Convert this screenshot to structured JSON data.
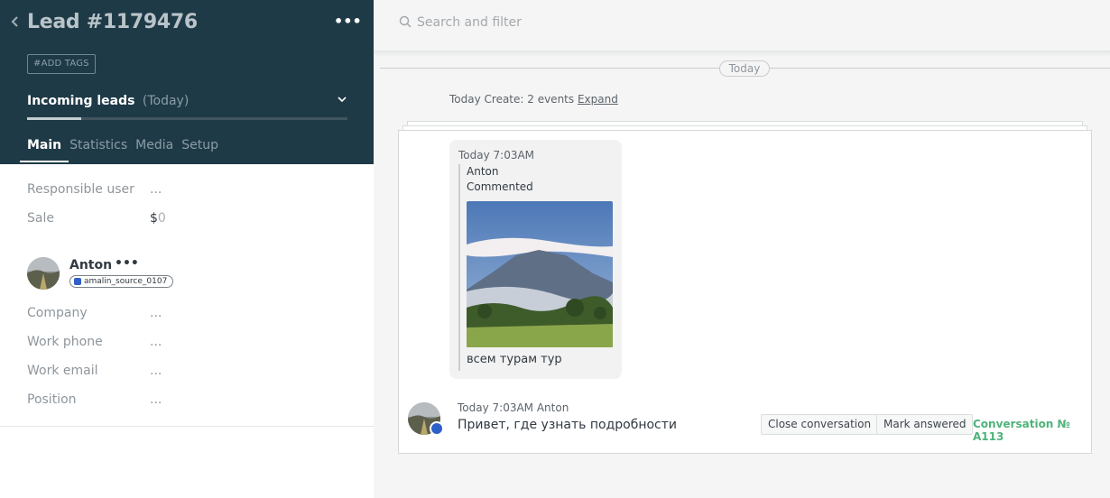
{
  "lead": {
    "back_icon": "chevron-left-icon",
    "title": "Lead #1179476",
    "more_label": "•••",
    "add_tags_label": "#ADD TAGS",
    "pipeline_name": "Incoming leads",
    "pipeline_when": "(Today)",
    "pipeline_progress": 0.17,
    "tabs": [
      "Main",
      "Statistics",
      "Media",
      "Setup"
    ],
    "active_tab": "Main"
  },
  "fields": {
    "responsible_label": "Responsible user",
    "responsible_value": "...",
    "sale_label": "Sale",
    "sale_currency": "$",
    "sale_amount": "0"
  },
  "contact": {
    "name": "Anton",
    "more_label": "•••",
    "source_tag": "amalin_source_0107",
    "company_label": "Company",
    "company_value": "...",
    "work_phone_label": "Work phone",
    "work_phone_value": "...",
    "work_email_label": "Work email",
    "work_email_value": "...",
    "position_label": "Position",
    "position_value": "..."
  },
  "search": {
    "placeholder": "Search and filter",
    "icon": "search-icon"
  },
  "feed": {
    "date_separator": "Today",
    "events_summary": "Today Create: 2 events",
    "expand_label": "Expand",
    "comment": {
      "time": "Today 7:03AM",
      "author": "Anton",
      "action": "Commented",
      "text": "всем турам тур"
    },
    "message": {
      "meta": "Today 7:03AM Anton",
      "text": "Привет, где узнать подробности",
      "close_label": "Close conversation",
      "mark_label": "Mark answered",
      "conversation_label": "Conversation № A113"
    }
  },
  "colors": {
    "sidebar": "#1f3a47",
    "accent_green": "#4fb37a"
  }
}
